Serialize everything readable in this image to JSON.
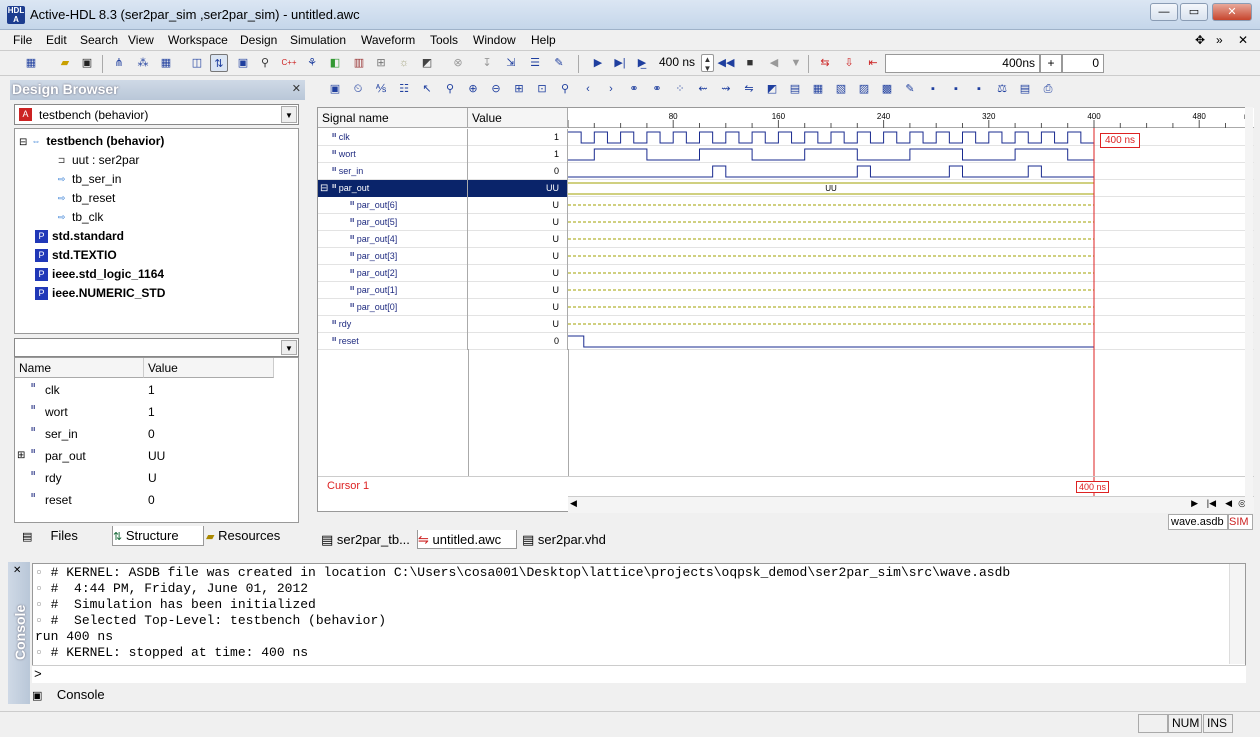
{
  "title": "Active-HDL 8.3 (ser2par_sim ,ser2par_sim) - untitled.awc",
  "app_icon": "HDL A",
  "window_buttons": [
    "—",
    "▭",
    "✕"
  ],
  "menu": [
    "File",
    "Edit",
    "Search",
    "View",
    "Workspace",
    "Design",
    "Simulation",
    "Waveform",
    "Tools",
    "Window",
    "Help"
  ],
  "menu_right": [
    "✥",
    "»",
    "✕"
  ],
  "toolbar": {
    "run_for": "400 ns",
    "time_display": "400ns",
    "plus": "+",
    "delta": "0"
  },
  "design_browser": {
    "header": "Design Browser",
    "combo": "testbench (behavior)",
    "tree": [
      {
        "label": "testbench (behavior)",
        "bold": true,
        "indent": 0,
        "icon": "entity-icon"
      },
      {
        "label": "uut : ser2par",
        "bold": false,
        "indent": 2,
        "icon": "component-icon"
      },
      {
        "label": "tb_ser_in",
        "bold": false,
        "indent": 2,
        "icon": "process-icon"
      },
      {
        "label": "tb_reset",
        "bold": false,
        "indent": 2,
        "icon": "process-icon"
      },
      {
        "label": "tb_clk",
        "bold": false,
        "indent": 2,
        "icon": "process-icon"
      },
      {
        "label": "std.standard",
        "bold": true,
        "indent": 1,
        "icon": "package-icon"
      },
      {
        "label": "std.TEXTIO",
        "bold": true,
        "indent": 1,
        "icon": "package-icon"
      },
      {
        "label": "ieee.std_logic_1164",
        "bold": true,
        "indent": 1,
        "icon": "package-icon"
      },
      {
        "label": "ieee.NUMERIC_STD",
        "bold": true,
        "indent": 1,
        "icon": "package-icon"
      }
    ],
    "grid_headers": [
      "Name",
      "Value"
    ],
    "grid": [
      {
        "name": "clk",
        "value": "1"
      },
      {
        "name": "wort",
        "value": "1"
      },
      {
        "name": "ser_in",
        "value": "0"
      },
      {
        "name": "par_out",
        "value": "UU"
      },
      {
        "name": "rdy",
        "value": "U"
      },
      {
        "name": "reset",
        "value": "0"
      }
    ],
    "tabs": [
      "Files",
      "Structure",
      "Resources"
    ]
  },
  "waveform": {
    "col_signal": "Signal name",
    "col_value": "Value",
    "ruler_ticks": [
      "80",
      "160",
      "240",
      "320",
      "400",
      "480"
    ],
    "ruler_unit": "ns",
    "signals": [
      {
        "name": "clk",
        "value": "1",
        "indent": 0
      },
      {
        "name": "wort",
        "value": "1",
        "indent": 0
      },
      {
        "name": "ser_in",
        "value": "0",
        "indent": 0
      },
      {
        "name": "par_out",
        "value": "UU",
        "indent": 0,
        "selected": true,
        "bus": "UU"
      },
      {
        "name": "par_out[6]",
        "value": "U",
        "indent": 1
      },
      {
        "name": "par_out[5]",
        "value": "U",
        "indent": 1
      },
      {
        "name": "par_out[4]",
        "value": "U",
        "indent": 1
      },
      {
        "name": "par_out[3]",
        "value": "U",
        "indent": 1
      },
      {
        "name": "par_out[2]",
        "value": "U",
        "indent": 1
      },
      {
        "name": "par_out[1]",
        "value": "U",
        "indent": 1
      },
      {
        "name": "par_out[0]",
        "value": "U",
        "indent": 1
      },
      {
        "name": "rdy",
        "value": "U",
        "indent": 0
      },
      {
        "name": "reset",
        "value": "0",
        "indent": 0
      }
    ],
    "cursor_label": "Cursor 1",
    "cursor_time": "400 ns",
    "status_right": [
      "wave.asdb",
      "SIM"
    ],
    "colors": {
      "wave": "#1a2b8f",
      "cursor": "#d22",
      "selected": "#0a246a",
      "undefined": "#a0a000"
    }
  },
  "doc_tabs": [
    "ser2par_tb...",
    "untitled.awc",
    "ser2par.vhd"
  ],
  "console": {
    "side_label": "Console",
    "lines": [
      "# KERNEL: ASDB file was created in location C:\\Users\\cosa001\\Desktop\\lattice\\projects\\oqpsk_demod\\ser2par_sim\\src\\wave.asdb",
      "#  4:44 PM, Friday, June 01, 2012",
      "#  Simulation has been initialized",
      "#  Selected Top-Level: testbench (behavior)",
      "run 400 ns",
      "# KERNEL: stopped at time: 400 ns"
    ],
    "prompt": ">",
    "tab": "Console"
  },
  "statusbar": [
    "NUM",
    "INS"
  ]
}
